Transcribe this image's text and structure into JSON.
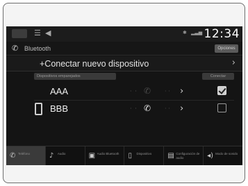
{
  "status": {
    "clock": "12:34"
  },
  "header": {
    "title": "Bluetooth",
    "top_button": "Opciones"
  },
  "connect": {
    "label": "+Conectar nuevo dispositivo"
  },
  "columns": {
    "left": "Dispositivos emparejados",
    "right": "Conectar"
  },
  "devices": [
    {
      "name": "AAA",
      "call_active": false,
      "checked": true
    },
    {
      "name": "BBB",
      "call_active": true,
      "checked": false
    }
  ],
  "nav": [
    {
      "icon": "phone-icon",
      "label": "Teléfono"
    },
    {
      "icon": "audio-icon",
      "label": "Audio"
    },
    {
      "icon": "media-icon",
      "label": "Audio Bluetooth"
    },
    {
      "icon": "device-icon",
      "label": "Dispositivo"
    },
    {
      "icon": "settings-icon",
      "label": "Configuración de audio"
    },
    {
      "icon": "volume-icon",
      "label": "Modo de sonido"
    }
  ]
}
